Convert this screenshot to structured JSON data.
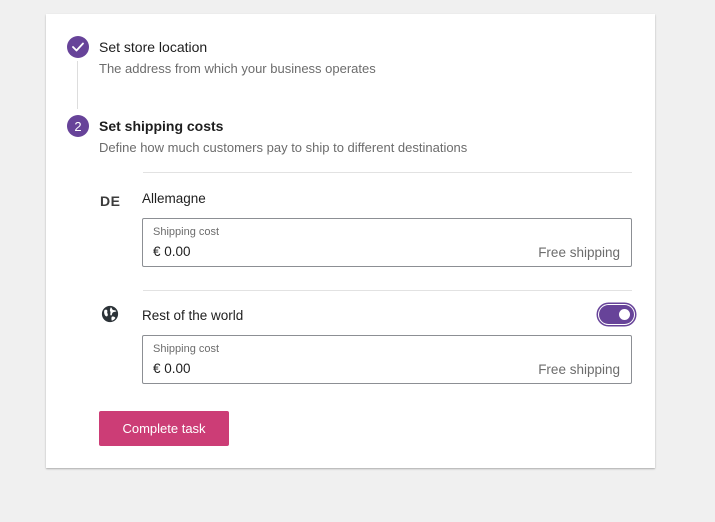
{
  "steps": [
    {
      "number": "",
      "title": "Set store location",
      "description": "The address from which your business operates",
      "status": "completed"
    },
    {
      "number": "2",
      "title": "Set shipping costs",
      "description": "Define how much customers pay to ship to different destinations",
      "status": "active"
    }
  ],
  "zones": [
    {
      "code": "DE",
      "name": "Allemagne",
      "cost_label": "Shipping cost",
      "cost_value": "€ 0.00",
      "cost_hint": "Free shipping"
    },
    {
      "icon": "globe-icon",
      "name": "Rest of the world",
      "toggle_on": true,
      "cost_label": "Shipping cost",
      "cost_value": "€ 0.00",
      "cost_hint": "Free shipping"
    }
  ],
  "actions": {
    "complete_label": "Complete task"
  },
  "colors": {
    "accent": "#674399",
    "button": "#cc3d76"
  }
}
